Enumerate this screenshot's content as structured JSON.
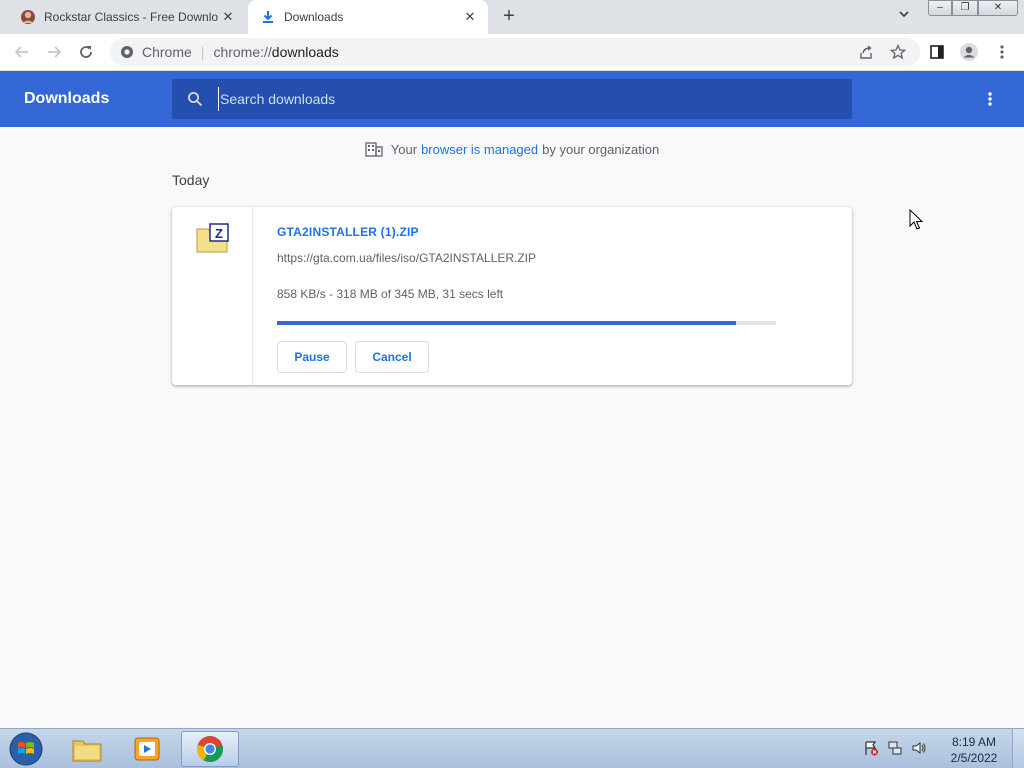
{
  "tabs": [
    {
      "title": "Rockstar Classics - Free Downloa",
      "favicon": "rockstar-avatar-icon",
      "active": false
    },
    {
      "title": "Downloads",
      "favicon": "download-icon",
      "active": true
    }
  ],
  "toolbar": {
    "site_chip": "Chrome",
    "url_scheme": "chrome://",
    "url_host": "downloads"
  },
  "downloads_header": {
    "title": "Downloads",
    "search_placeholder": "Search downloads"
  },
  "managed_notice": {
    "prefix": "Your",
    "link": "browser is managed",
    "suffix": "by your organization"
  },
  "section_label": "Today",
  "download": {
    "file_name": "GTA2INSTALLER (1).ZIP",
    "url": "https://gta.com.ua/files/iso/GTA2INSTALLER.ZIP",
    "status": "858 KB/s - 318 MB of 345 MB, 31 secs left",
    "progress_fraction": 0.92,
    "pause_label": "Pause",
    "cancel_label": "Cancel",
    "file_icon": "zip-archive-icon"
  },
  "taskbar": {
    "apps": [
      "windows-explorer-icon",
      "media-player-icon",
      "chrome-icon"
    ],
    "active_app": "chrome-icon",
    "time": "8:19 AM",
    "date": "2/5/2022"
  },
  "colors": {
    "header_blue": "#3367d6",
    "search_bg": "#254fae",
    "link_blue": "#1a73e8",
    "page_bg": "#f8f9fa"
  }
}
